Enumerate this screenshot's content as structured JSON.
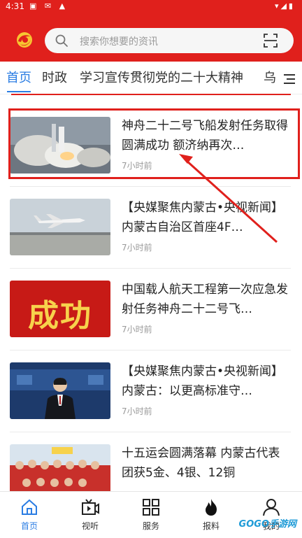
{
  "status_bar": {
    "time": "4:31",
    "left_icons": "▣ ✉ ▲",
    "right_icons": "▾◢▮"
  },
  "search": {
    "placeholder": "搜索你想要的资讯"
  },
  "tabs": [
    {
      "label": "首页",
      "active": true
    },
    {
      "label": "时政",
      "active": false
    },
    {
      "label": "学习宣传贯彻党的二十大精神",
      "active": false
    },
    {
      "label": "乌",
      "active": false
    }
  ],
  "news": [
    {
      "title": "神舟二十二号飞船发射任务取得圆满成功  额济纳再次…",
      "time": "7小时前",
      "thumb": "rocket-launch"
    },
    {
      "title": "【央媒聚焦内蒙古•央视新闻】内蒙古自治区首座4F…",
      "time": "7小时前",
      "thumb": "airplane"
    },
    {
      "title": "中国载人航天工程第一次应急发射任务神舟二十二号飞…",
      "time": "7小时前",
      "thumb": "chenggong",
      "thumb_text": "成功"
    },
    {
      "title": "【央媒聚焦内蒙古•央视新闻】内蒙古：以更高标准守…",
      "time": "7小时前",
      "thumb": "news-anchor"
    },
    {
      "title": "十五运会圆满落幕  内蒙古代表团获5金、4银、12铜",
      "time": "",
      "thumb": "team-photo"
    }
  ],
  "bottom_nav": [
    {
      "label": "首页",
      "icon": "home-icon",
      "active": true
    },
    {
      "label": "视听",
      "icon": "video-icon",
      "active": false
    },
    {
      "label": "服务",
      "icon": "grid-icon",
      "active": false
    },
    {
      "label": "报料",
      "icon": "flame-icon",
      "active": false
    },
    {
      "label": "我的",
      "icon": "user-icon",
      "active": false
    }
  ],
  "watermark": "GOGO手游网",
  "colors": {
    "brand_red": "#e0201c",
    "active_blue": "#2b7de3"
  }
}
